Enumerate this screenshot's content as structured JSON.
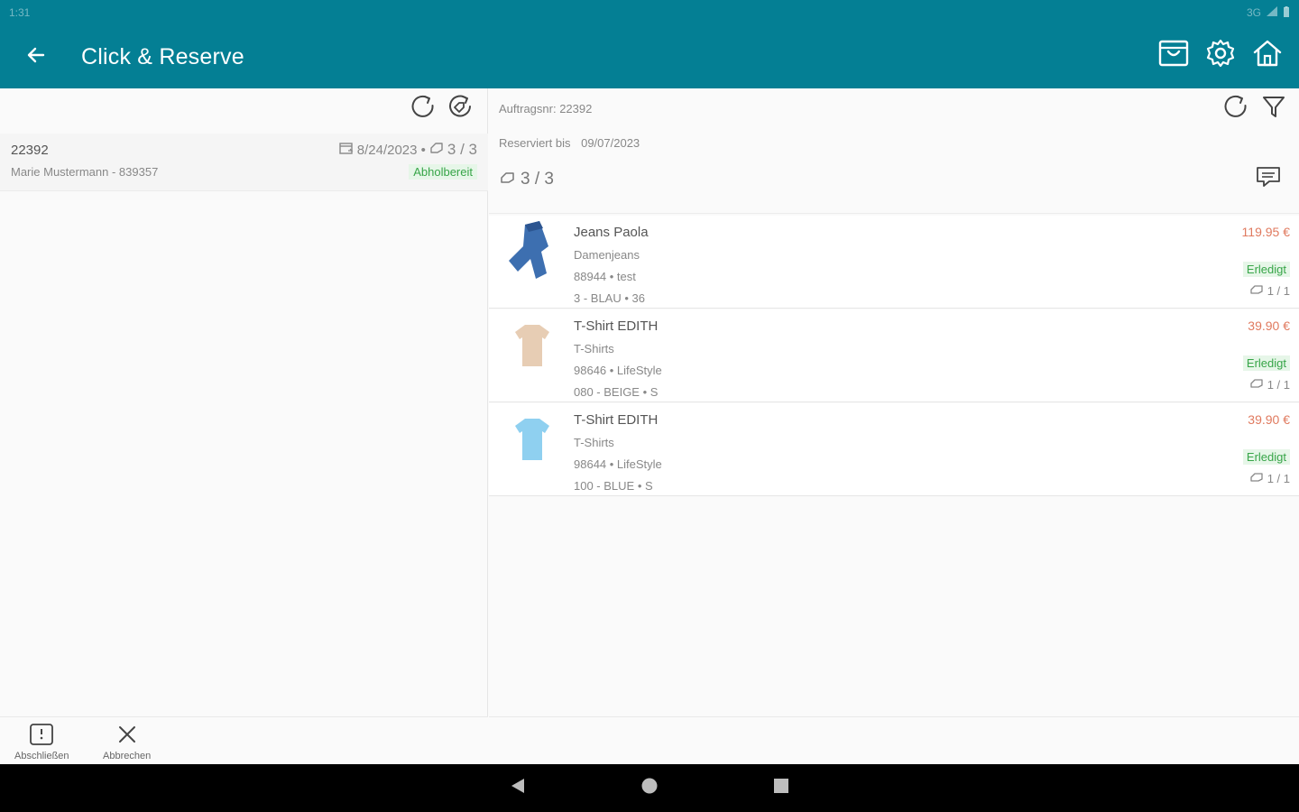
{
  "status_bar": {
    "time": "1:31",
    "network": "3G"
  },
  "app_bar": {
    "title": "Click & Reserve",
    "icons": [
      "arrow-back-icon",
      "shopping-bag-icon",
      "settings-gear-icon",
      "home-icon"
    ]
  },
  "order_list": {
    "orders": [
      {
        "number": "22392",
        "customer": "Marie Mustermann - 839357",
        "date": "8/24/2023 •",
        "count": "3 / 3",
        "status": "Abholbereit"
      }
    ],
    "footer": {
      "complete_label": "Abschließen",
      "cancel_label": "Abbrechen"
    }
  },
  "order_detail": {
    "order_no_line": "Auftragsnr: 22392",
    "reserved_label": "Reserviert bis",
    "reserved_date": "09/07/2023",
    "total_count": "3 / 3",
    "items": [
      {
        "name": "Jeans Paola",
        "category": "Damenjeans",
        "article": "88944 • test",
        "variant": "3 - BLAU • 36",
        "price": "119.95 €",
        "status": "Erledigt",
        "qty": "1 / 1",
        "thumb_color": "#3d6fb0"
      },
      {
        "name": "T-Shirt EDITH",
        "category": "T-Shirts",
        "article": "98646 • LifeStyle",
        "variant": "080 - BEIGE • S",
        "price": "39.90 €",
        "status": "Erledigt",
        "qty": "1 / 1",
        "thumb_color": "#e7cdb4"
      },
      {
        "name": "T-Shirt EDITH",
        "category": "T-Shirts",
        "article": "98644 • LifeStyle",
        "variant": "100 - BLUE • S",
        "price": "39.90 €",
        "status": "Erledigt",
        "qty": "1 / 1",
        "thumb_color": "#8fd0f0"
      }
    ]
  },
  "colors": {
    "primary": "#047f94",
    "status_green": "#37a548",
    "status_green_bg": "#e6f6e8",
    "price": "#e07a5f"
  }
}
